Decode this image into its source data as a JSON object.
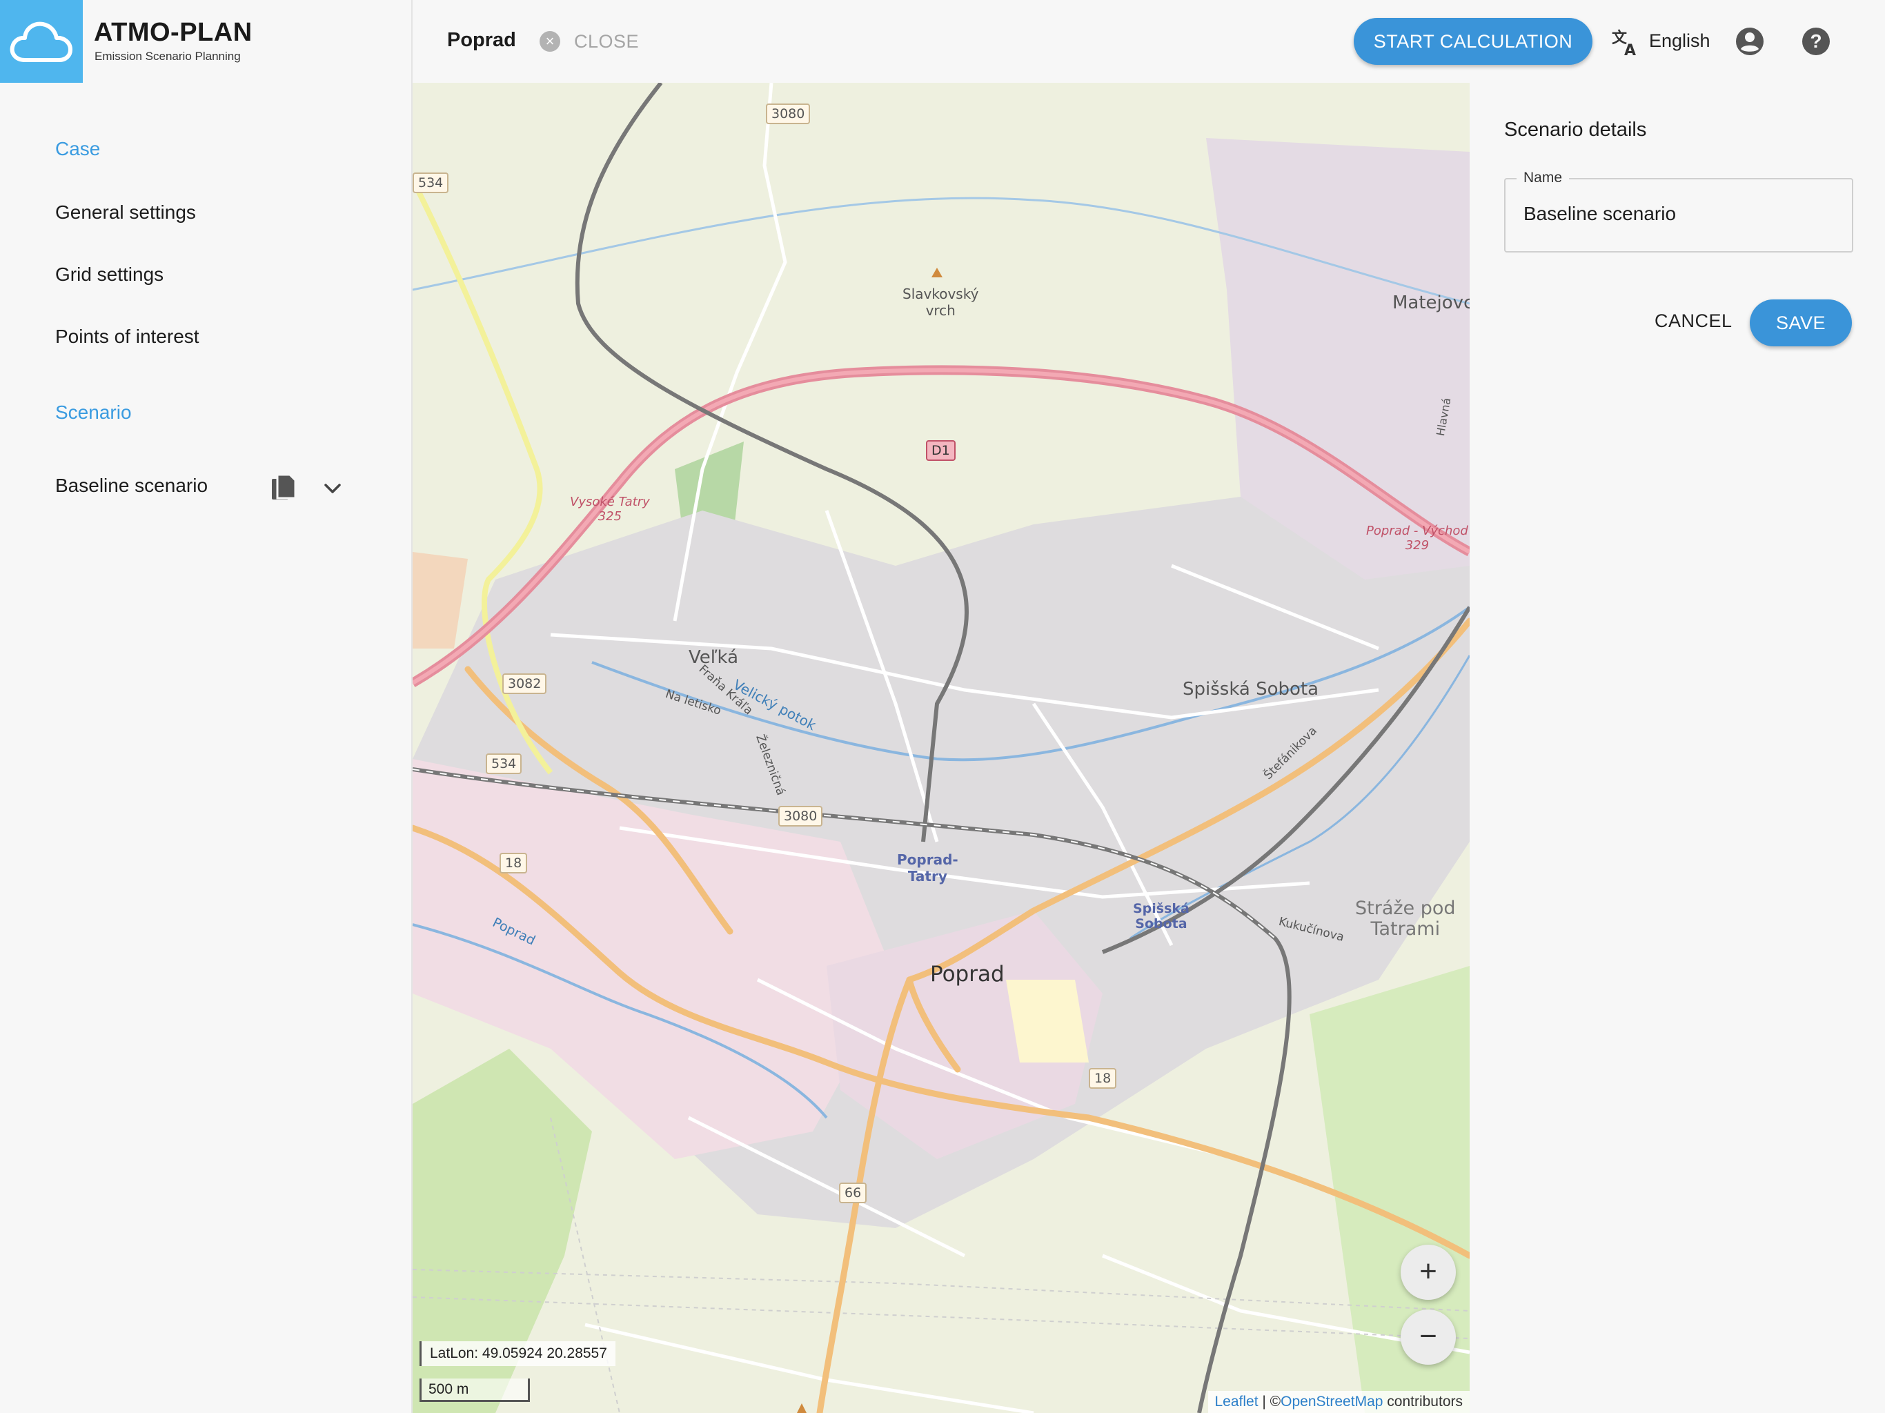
{
  "app": {
    "title": "ATMO-PLAN",
    "subtitle": "Emission Scenario Planning",
    "accent_color": "#3a94d9",
    "logo_color": "#4fb6ee"
  },
  "sidebar": {
    "case_section": "Case",
    "items": [
      "General settings",
      "Grid settings",
      "Points of interest"
    ],
    "scenario_section": "Scenario",
    "scenario_item": "Baseline scenario",
    "scenario_icons": [
      "copy-icon",
      "chevron-down-icon"
    ]
  },
  "topbar": {
    "case_name": "Poprad",
    "close_label": "CLOSE",
    "start_label": "START CALCULATION",
    "language": "English",
    "icons": [
      "translate-icon",
      "account-icon",
      "help-icon"
    ]
  },
  "map": {
    "labels": {
      "slavkovsky": "Slavkovský\nvrch",
      "matejovce": "Matejovc",
      "velka": "Veľká",
      "velicky": "Velický potok",
      "frana": "Fraňa Kráľa",
      "na_letisko": "Na letisko",
      "zeleznicna": "Železničná",
      "spisska_sobota": "Spišská Sobota",
      "stefanikova": "Štefánikova",
      "poprad_tatry": "Poprad-\nTatry",
      "poprad": "Poprad",
      "spisska_sobota_stn": "Spišská\nSobota",
      "kukucinova": "Kukučínova",
      "straze": "Stráže pod\nTatrami",
      "poprad_river": "Poprad",
      "vysoke_tatry": "Vysoké Tatry\n325",
      "poprad_vychod": "Poprad - Východ\n329",
      "hlavna": "Hlavná"
    },
    "shields": [
      "3080",
      "534",
      "D1",
      "3082",
      "534",
      "3080",
      "18",
      "18",
      "66"
    ],
    "zoom_in": "+",
    "zoom_out": "−",
    "coords": "LatLon: 49.05924 20.28557",
    "scale": "500 m",
    "attribution_leaflet": "Leaflet",
    "attribution_sep": " | ©",
    "attribution_osm": "OpenStreetMap",
    "attribution_tail": " contributors"
  },
  "panel": {
    "title": "Scenario details",
    "name_label": "Name",
    "name_value": "Baseline scenario",
    "cancel_label": "CANCEL",
    "save_label": "SAVE"
  }
}
